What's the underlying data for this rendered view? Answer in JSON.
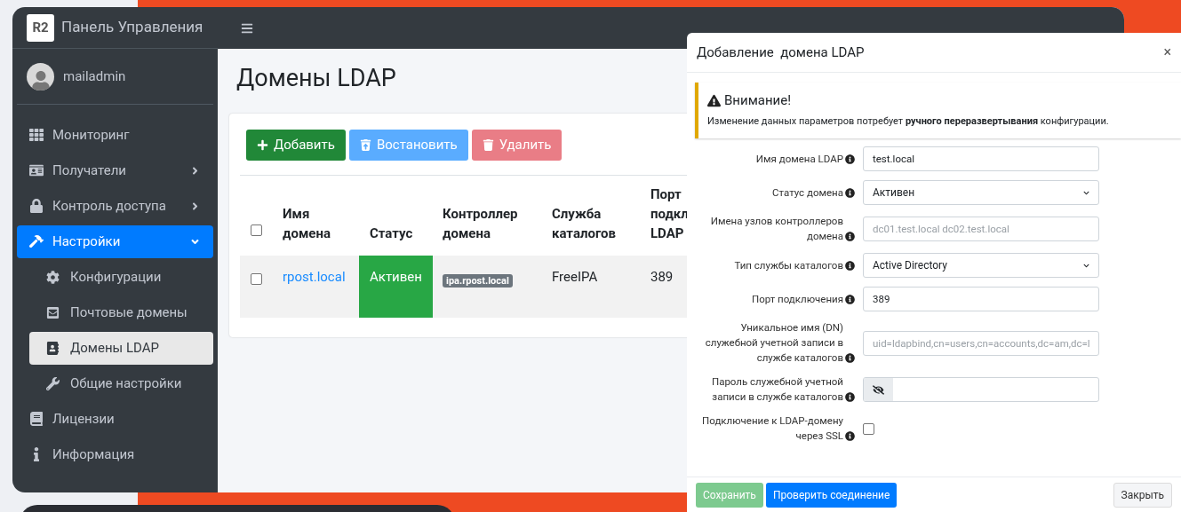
{
  "brand": {
    "logo": "R2",
    "title": "Панель Управления"
  },
  "user": {
    "name": "mailadmin"
  },
  "sidebar": {
    "items": [
      {
        "label": "Мониторинг",
        "kind": "link",
        "selected": false
      },
      {
        "label": "Получатели",
        "kind": "group",
        "expanded": false,
        "selected": false
      },
      {
        "label": "Контроль доступа",
        "kind": "group",
        "expanded": false,
        "selected": false
      },
      {
        "label": "Настройки",
        "kind": "group",
        "expanded": true,
        "selected": true,
        "children": [
          {
            "label": "Конфигурации",
            "selected": false
          },
          {
            "label": "Почтовые домены",
            "selected": false
          },
          {
            "label": "Домены LDAP",
            "selected": true
          },
          {
            "label": "Общие настройки",
            "selected": false
          }
        ]
      },
      {
        "label": "Лицензии",
        "kind": "link",
        "selected": false
      },
      {
        "label": "Информация",
        "kind": "link",
        "selected": false
      }
    ]
  },
  "page": {
    "title": "Домены LDAP"
  },
  "toolbar": {
    "buttons": [
      {
        "label": "Добавить",
        "kind": "add"
      },
      {
        "label": "Востановить",
        "kind": "restore"
      },
      {
        "label": "Удалить",
        "kind": "delete"
      }
    ]
  },
  "table": {
    "header_checked": false,
    "columns": [
      "Имя домена",
      "Статус",
      "Контроллер домена",
      "Служба каталогов",
      "Порт подкл LDAP"
    ],
    "rows": [
      {
        "checked": false,
        "name": "rpost.local",
        "status": "Активен",
        "controller": "ipa.rpost.local",
        "service": "FreeIPA",
        "port": "389"
      }
    ]
  },
  "modal": {
    "title": "Добавление  домена LDAP",
    "close": "×",
    "alert": {
      "title": "Внимание!",
      "text": "Изменение данных параметров потребует **ручного переразвертывания** конфигурации."
    },
    "fields": [
      {
        "label": "Имя домена LDAP",
        "kind": "text",
        "value": "test.local"
      },
      {
        "label": "Статус домена",
        "kind": "select",
        "value": "Активен"
      },
      {
        "label": "Имена узлов контроллеров домена",
        "kind": "text",
        "placeholder": "dc01.test.local dc02.test.local"
      },
      {
        "label": "Тип службы каталогов",
        "kind": "select",
        "value": "Active Directory"
      },
      {
        "label": "Порт подключения",
        "kind": "text",
        "value": "389"
      },
      {
        "label": "Уникальное имя (DN) служебной учетной записи в службе каталогов",
        "kind": "text",
        "placeholder": "uid=ldapbind,cn=users,cn=accounts,dc=am,dc=l"
      },
      {
        "label": "Пароль служебной учетной записи в службе каталогов",
        "kind": "password"
      },
      {
        "label": "Подключение к LDAP-домену через SSL",
        "kind": "checkbox",
        "checked": false
      }
    ],
    "buttons": [
      {
        "label": "Сохранить",
        "kind": "save",
        "disabled": true
      },
      {
        "label": "Проверить соединение",
        "kind": "test",
        "disabled": false
      },
      {
        "label": "Закрыть",
        "kind": "close",
        "disabled": false
      }
    ]
  }
}
